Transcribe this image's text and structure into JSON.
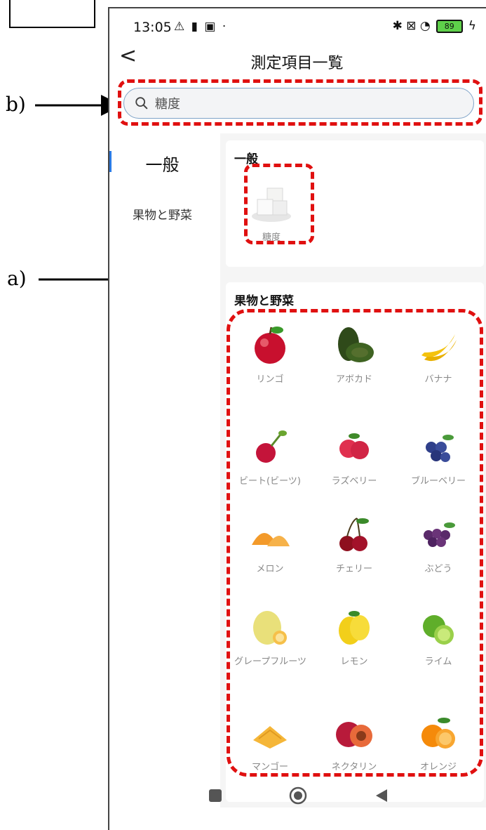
{
  "status": {
    "time": "13:05",
    "left_icons": "⚠ ▮ ▣ ·",
    "right_icons": "✱ ⊠ ◔",
    "battery": "89",
    "charging": "ϟ"
  },
  "header": {
    "back_glyph": "<",
    "title": "測定項目一覧"
  },
  "search": {
    "value": "糖度",
    "icon": "search-icon"
  },
  "sidebar": {
    "items": [
      {
        "label": "一般",
        "selected": true
      },
      {
        "label": "果物と野菜",
        "selected": false
      }
    ],
    "accent": "#2a7ae4"
  },
  "sections": {
    "general": {
      "title": "一般",
      "items": [
        {
          "label": "糖度"
        }
      ]
    },
    "fruits": {
      "title": "果物と野菜",
      "items": [
        {
          "label": "リンゴ"
        },
        {
          "label": "アボカド"
        },
        {
          "label": "バナナ"
        },
        {
          "label": "ビート(ビーツ)"
        },
        {
          "label": "ラズベリー"
        },
        {
          "label": "ブルーベリー"
        },
        {
          "label": "メロン"
        },
        {
          "label": "チェリー"
        },
        {
          "label": "ぶどう"
        },
        {
          "label": "グレープフルーツ"
        },
        {
          "label": "レモン"
        },
        {
          "label": "ライム"
        },
        {
          "label": "マンゴー"
        },
        {
          "label": "ネクタリン"
        },
        {
          "label": "オレンジ"
        }
      ]
    }
  },
  "annotations": {
    "a": "a)",
    "b": "b)",
    "color": "#e01010"
  }
}
